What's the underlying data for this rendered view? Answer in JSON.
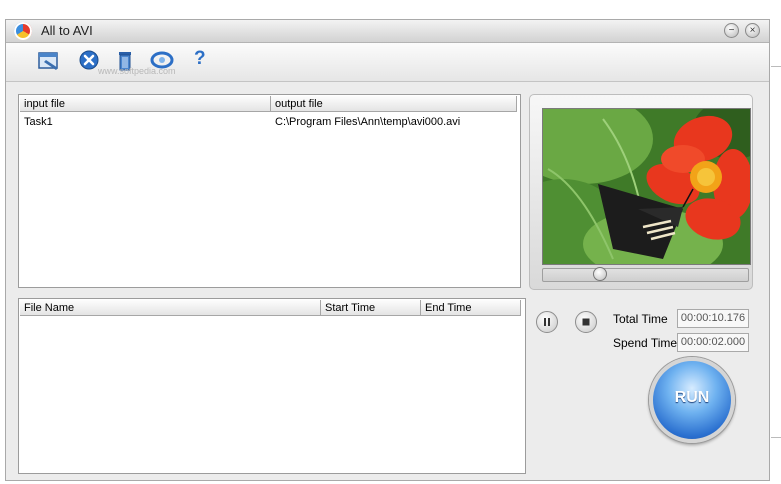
{
  "window": {
    "title": "All to AVI",
    "minimize_label": "−",
    "close_label": "×"
  },
  "toolbar": {
    "buttons": [
      {
        "name": "open-icon"
      },
      {
        "name": "remove-icon"
      },
      {
        "name": "trash-icon"
      },
      {
        "name": "settings-icon"
      },
      {
        "name": "help-icon",
        "label": "?"
      }
    ],
    "watermark": "www.softpedia.com"
  },
  "task_list": {
    "headers": [
      "input file",
      "output file"
    ],
    "rows": [
      {
        "input": "Task1",
        "output": "C:\\Program Files\\Ann\\temp\\avi000.avi"
      }
    ]
  },
  "segments": {
    "headers": [
      "File Name",
      "Start Time",
      "End Time"
    ],
    "rows": []
  },
  "preview": {
    "position": 0.26
  },
  "stats": {
    "total_label": "Total  Time",
    "total_value": "00:00:10.176",
    "spend_label": "Spend  Time",
    "spend_value": "00:00:02.000"
  },
  "run_label": "RUN",
  "colors": {
    "run_blue": "#2a6fcf",
    "flower_red": "#e8371e",
    "leaf_green": "#5f9e3a"
  }
}
